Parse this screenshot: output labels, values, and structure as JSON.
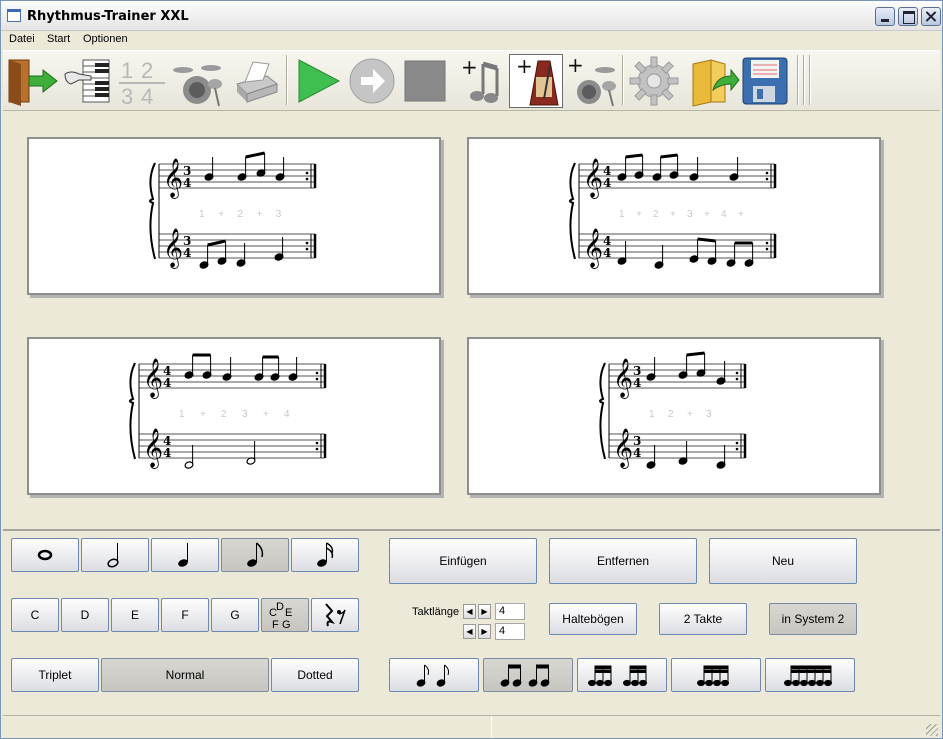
{
  "window": {
    "title": "Rhythmus-Trainer XXL"
  },
  "menu": [
    "Datei",
    "Start",
    "Optionen"
  ],
  "toolbar": {
    "icons": [
      "exit-door-icon",
      "keyboard-hand-icon",
      "time-signature-icon",
      "drum-kit-icon",
      "printer-icon",
      "play-icon",
      "forward-arrow-icon",
      "stop-icon",
      "add-note-icon",
      "metronome-icon",
      "add-drums-icon",
      "settings-gear-icon",
      "open-folder-icon",
      "save-disk-icon"
    ],
    "time_sig_digits": [
      "1",
      "2",
      "3",
      "4"
    ]
  },
  "cards": [
    {
      "top_sig": [
        "3",
        "4"
      ],
      "bottom_sig": [
        "3",
        "4"
      ],
      "counts": [
        "1",
        "+",
        "2",
        "+",
        "3"
      ]
    },
    {
      "top_sig": [
        "4",
        "4"
      ],
      "bottom_sig": [
        "4",
        "4"
      ],
      "counts": [
        "1",
        "+",
        "2",
        "+",
        "3",
        "+",
        "4",
        "+"
      ]
    },
    {
      "top_sig": [
        "4",
        "4"
      ],
      "bottom_sig": [
        "4",
        "4"
      ],
      "counts": [
        "1",
        "+",
        "2",
        "3",
        "+",
        "4"
      ]
    },
    {
      "top_sig": [
        "3",
        "4"
      ],
      "bottom_sig": [
        "3",
        "4"
      ],
      "counts": [
        "1",
        "2",
        "+",
        "3"
      ]
    }
  ],
  "panel": {
    "note_values": [
      "whole-note-icon",
      "half-note-icon",
      "quarter-note-icon",
      "eighth-note-icon",
      "sixteenth-note-icon"
    ],
    "pitches": [
      "C",
      "D",
      "E",
      "F",
      "G"
    ],
    "cdefg_icon_letters": [
      "C",
      "D",
      "E",
      "F",
      "G"
    ],
    "modifiers": {
      "triplet": "Triplet",
      "normal": "Normal",
      "dotted": "Dotted"
    },
    "actions": {
      "insert": "Einfügen",
      "remove": "Entfernen",
      "new": "Neu"
    },
    "measure": {
      "label": "Taktlänge",
      "numerator": "4",
      "denominator": "4"
    },
    "toggles": {
      "ties": "Haltebögen",
      "two_bars": "2 Takte",
      "in_system": "in System 2"
    },
    "groupings": [
      "two-eighths-icon",
      "two-beamed-pairs-icon",
      "two-sixteenth-groups-icon",
      "four-beamed-icon",
      "six-beamed-icon"
    ]
  },
  "colors": {
    "accent_play": "#3fbf4f",
    "window_bg": "#ece9d8",
    "button_border": "#6f88ad"
  }
}
